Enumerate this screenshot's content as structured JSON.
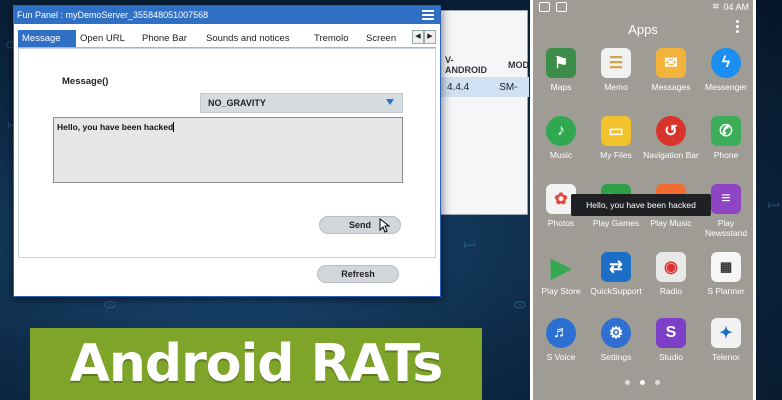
{
  "matrix_digits": [
    "0",
    "1",
    "0",
    "1",
    "0",
    "1"
  ],
  "background_window": {
    "columns": [
      "V-ANDROID",
      "MOD"
    ],
    "row": [
      "4.4.4",
      "SM-"
    ]
  },
  "panel": {
    "title": "Fun Panel : myDemoServer_355848051007568",
    "tabs": [
      {
        "label": "Message",
        "active": true
      },
      {
        "label": "Open URL"
      },
      {
        "label": "Phone Bar"
      },
      {
        "label": "Sounds and notices"
      },
      {
        "label": "Tremolo"
      },
      {
        "label": "Screen"
      }
    ],
    "message_label": "Message()",
    "gravity_value": "NO_GRAVITY",
    "message_text": "Hello, you have been hacked",
    "send_label": "Send",
    "refresh_label": "Refresh"
  },
  "phone": {
    "status_time": "04 AM",
    "apps_title": "Apps",
    "toast": "Hello, you have been hacked",
    "apps": [
      {
        "label": "Maps",
        "icon": "maps-icon",
        "color": "#3d8d4a"
      },
      {
        "label": "Memo",
        "icon": "memo-icon",
        "color": "#f1f1f1"
      },
      {
        "label": "Messages",
        "icon": "messages-icon",
        "color": "#f2b33a"
      },
      {
        "label": "Messenger",
        "icon": "messenger-icon",
        "color": "#1b8ff1"
      },
      {
        "label": "Music",
        "icon": "music-icon",
        "color": "#2fa84f"
      },
      {
        "label": "My Files",
        "icon": "my-files-icon",
        "color": "#f2c22c"
      },
      {
        "label": "Navigation Bar",
        "icon": "navigation-bar-icon",
        "color": "#d9342b"
      },
      {
        "label": "Phone",
        "icon": "phone-icon",
        "color": "#3cad58"
      },
      {
        "label": "Photos",
        "icon": "photos-icon",
        "color": "#f3f3f3"
      },
      {
        "label": "Play Games",
        "icon": "play-games-icon",
        "color": "#2c9f47"
      },
      {
        "label": "Play Music",
        "icon": "play-music-icon",
        "color": "#f26b2f"
      },
      {
        "label": "Play Newsstand",
        "icon": "play-newsstand-icon",
        "color": "#8e44c4"
      },
      {
        "label": "Play Store",
        "icon": "play-store-icon",
        "color": "#ffffff"
      },
      {
        "label": "QuickSupport",
        "icon": "quicksupport-icon",
        "color": "#1c6fc4"
      },
      {
        "label": "Radio",
        "icon": "radio-icon",
        "color": "#e8e8e8"
      },
      {
        "label": "S Planner",
        "icon": "s-planner-icon",
        "color": "#f6f6f6"
      },
      {
        "label": "S Voice",
        "icon": "s-voice-icon",
        "color": "#2a6fd1"
      },
      {
        "label": "Settings",
        "icon": "settings-icon",
        "color": "#2f6fd2"
      },
      {
        "label": "Studio",
        "icon": "studio-icon",
        "color": "#7e3fc7"
      },
      {
        "label": "Telenor",
        "icon": "telenor-icon",
        "color": "#f2f2f2"
      }
    ]
  },
  "banner": "Android RATs"
}
